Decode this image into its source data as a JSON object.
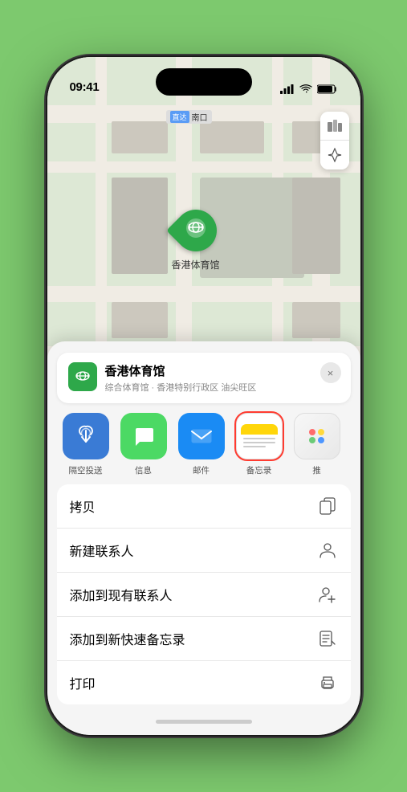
{
  "status_bar": {
    "time": "09:41",
    "signal_label": "signal",
    "wifi_label": "wifi",
    "battery_label": "battery"
  },
  "map": {
    "label": "南口",
    "controls": {
      "map_icon": "🗺",
      "location_icon": "⬆"
    },
    "pin": {
      "label": "香港体育馆"
    }
  },
  "location_card": {
    "name": "香港体育馆",
    "subtitle": "综合体育馆 · 香港特别行政区 油尖旺区",
    "close_label": "×"
  },
  "share_actions": [
    {
      "id": "airdrop",
      "label": "隔空投送",
      "type": "airdrop"
    },
    {
      "id": "message",
      "label": "信息",
      "type": "message"
    },
    {
      "id": "mail",
      "label": "邮件",
      "type": "mail"
    },
    {
      "id": "notes",
      "label": "备忘录",
      "type": "notes",
      "selected": true
    },
    {
      "id": "more",
      "label": "推",
      "type": "more"
    }
  ],
  "action_items": [
    {
      "label": "拷贝",
      "icon": "copy"
    },
    {
      "label": "新建联系人",
      "icon": "person"
    },
    {
      "label": "添加到现有联系人",
      "icon": "person-add"
    },
    {
      "label": "添加到新快速备忘录",
      "icon": "note"
    },
    {
      "label": "打印",
      "icon": "print"
    }
  ]
}
